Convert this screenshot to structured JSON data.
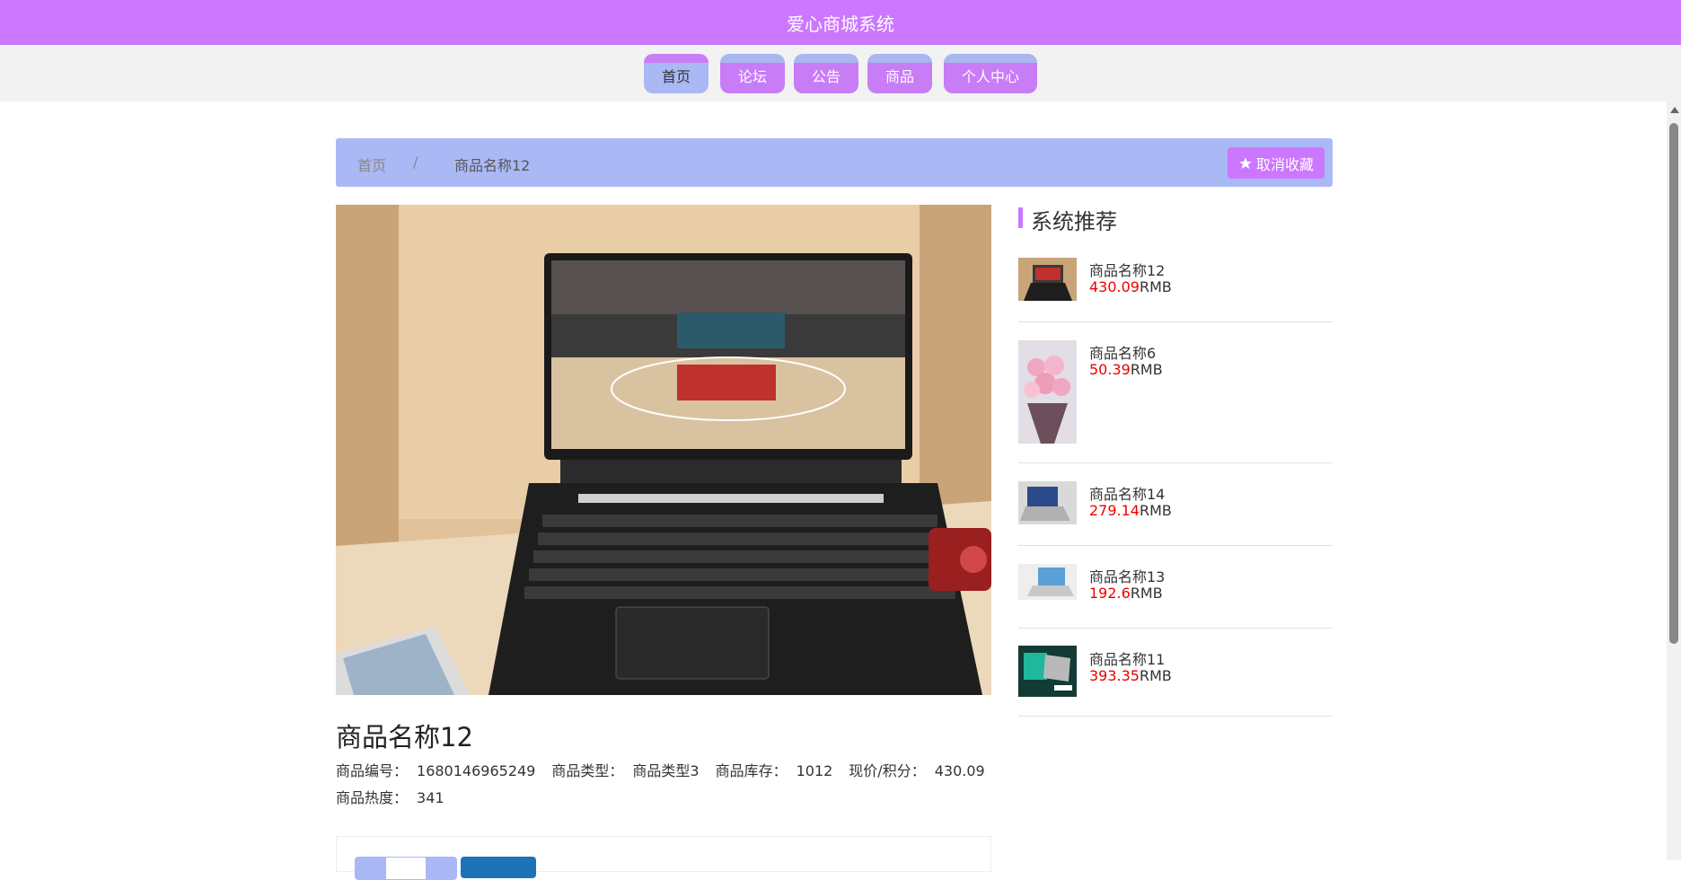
{
  "app": {
    "title": "爱心商城系统"
  },
  "nav": {
    "items": [
      {
        "label": "首页",
        "active": true
      },
      {
        "label": "论坛",
        "active": false
      },
      {
        "label": "公告",
        "active": false
      },
      {
        "label": "商品",
        "active": false
      },
      {
        "label": "个人中心",
        "active": false
      }
    ]
  },
  "breadcrumb": {
    "home": "首页",
    "separator": "/",
    "current": "商品名称12"
  },
  "favorite": {
    "label": "取消收藏",
    "icon": "star-icon"
  },
  "product": {
    "name": "商品名称12",
    "fields": [
      {
        "label": "商品编号：",
        "value": "1680146965249"
      },
      {
        "label": "商品类型：",
        "value": "商品类型3"
      },
      {
        "label": "商品库存：",
        "value": "1012"
      },
      {
        "label": "现价/积分：",
        "value": "430.09"
      }
    ],
    "heat": {
      "label": "商品热度：",
      "value": "341"
    }
  },
  "recommend": {
    "title": "系统推荐",
    "unit": "RMB",
    "items": [
      {
        "name": "商品名称12",
        "price": "430.09"
      },
      {
        "name": "商品名称6",
        "price": "50.39"
      },
      {
        "name": "商品名称14",
        "price": "279.14"
      },
      {
        "name": "商品名称13",
        "price": "192.6"
      },
      {
        "name": "商品名称11",
        "price": "393.35"
      }
    ]
  },
  "colors": {
    "accent": "#cc77ff",
    "secondary": "#aab8f5",
    "price": "#ee0000"
  }
}
